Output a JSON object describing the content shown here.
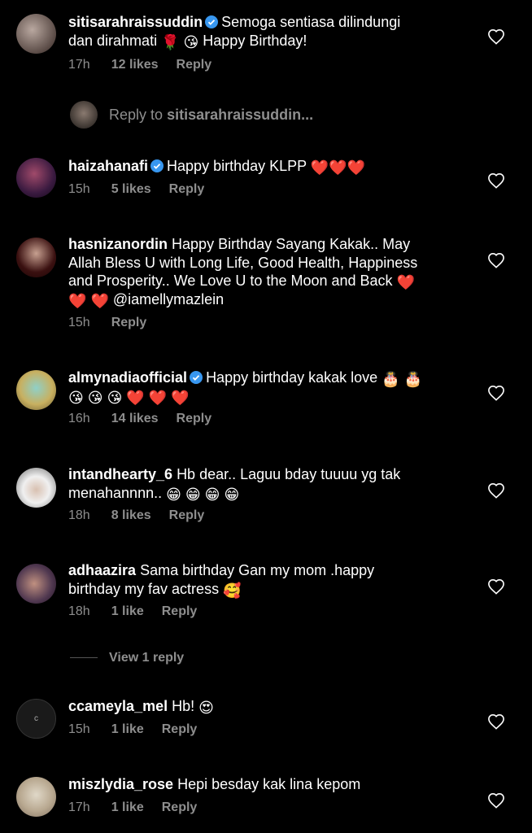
{
  "comments": [
    {
      "username": "sitisarahraissuddin",
      "verified": true,
      "text": "Semoga sentiasa dilindungi dan dirahmati 🌹😘 Happy Birthday!",
      "time": "17h",
      "likes": "12 likes",
      "reply": "Reply"
    },
    {
      "username": "haizahanafi",
      "verified": true,
      "text": "Happy birthday KLPP ❤️❤️❤️",
      "time": "15h",
      "likes": "5 likes",
      "reply": "Reply"
    },
    {
      "username": "hasnizanordin",
      "verified": false,
      "text": "Happy Birthday Sayang Kakak.. May Allah Bless U with Long Life, Good Health, Happiness and Prosperity.. We Love U to the Moon and Back ❤️❤️❤️ @iamellymazlein",
      "time": "15h",
      "likes": "",
      "reply": "Reply"
    },
    {
      "username": "almynadiaofficial",
      "verified": true,
      "text": "Happy birthday kakak love 🎂🎂😘😘😘❤️❤️❤️",
      "time": "16h",
      "likes": "14 likes",
      "reply": "Reply"
    },
    {
      "username": "intandhearty_6",
      "verified": false,
      "text": "Hb dear.. Laguu bday tuuuu yg tak menahannnn.. 😁😁😁😁",
      "time": "18h",
      "likes": "8 likes",
      "reply": "Reply"
    },
    {
      "username": "adhaazira",
      "verified": false,
      "text": "Sama birthday Gan my mom .happy birthday my fav actress 🥰",
      "time": "18h",
      "likes": "1 like",
      "reply": "Reply"
    },
    {
      "username": "ccameyla_mel",
      "verified": false,
      "text": "Hb! 😍",
      "time": "15h",
      "likes": "1 like",
      "reply": "Reply"
    },
    {
      "username": "miszlydia_rose",
      "verified": false,
      "text": "Hepi besday kak lina kepom",
      "time": "17h",
      "likes": "1 like",
      "reply": "Reply"
    }
  ],
  "reply_box": {
    "prefix": "Reply to",
    "target": "sitisarahraissuddin..."
  },
  "view_replies": "View 1 reply",
  "icons": {
    "like": "heart-outline-icon",
    "verified": "verified-badge-icon"
  },
  "colors": {
    "background": "#000000",
    "text": "#ffffff",
    "muted": "#8e8e8e",
    "verified": "#3897f0"
  }
}
